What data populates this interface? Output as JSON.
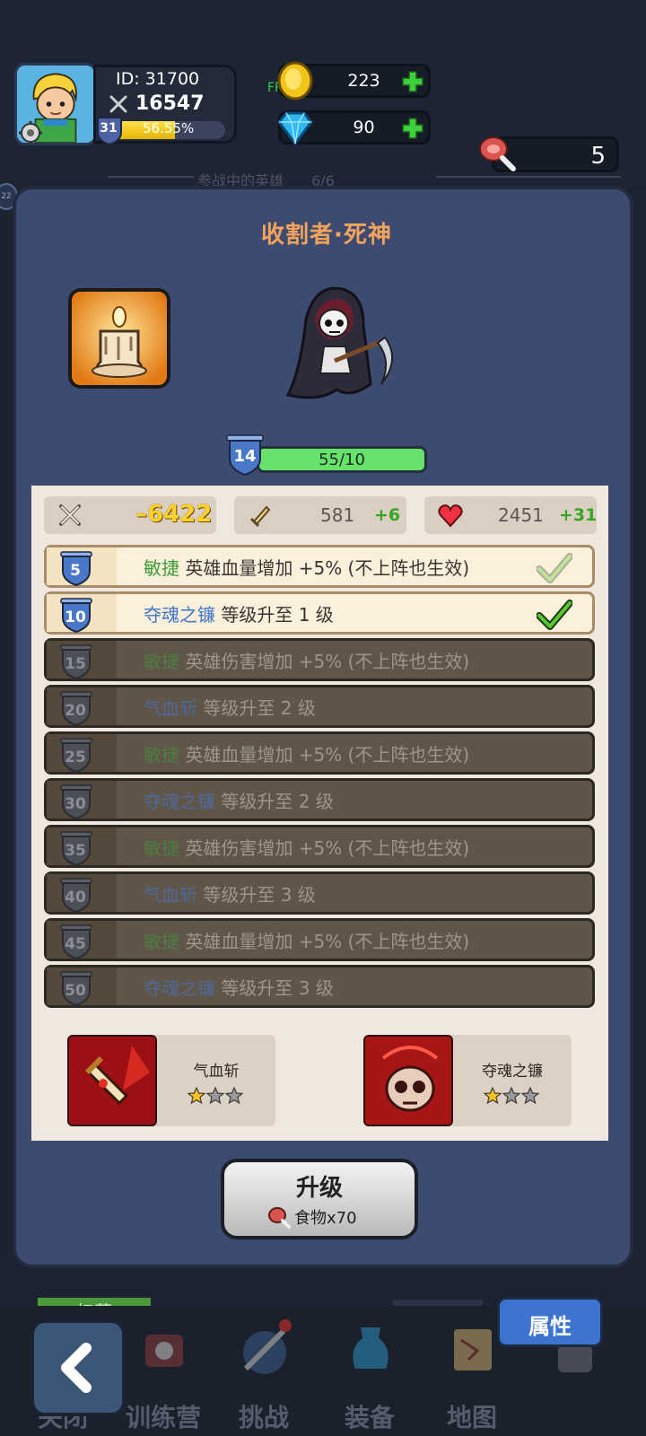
{
  "header": {
    "player_id": "ID: 31700",
    "combat_power": "16547",
    "player_level": "31",
    "xp_percent": "56.55%",
    "xp_fraction": 0.5655,
    "fps": "FPS60",
    "gold": "223",
    "gems": "90",
    "meat": "5",
    "heroes_hint": "参战中的英雄",
    "heroes_count": "6/6",
    "side_badge": "22"
  },
  "hero": {
    "title": "收割者·死神",
    "level": "14",
    "exp_text": "55/10",
    "exp_fraction": 1.0
  },
  "stats": {
    "attack": "–6422",
    "defense_value": "581",
    "defense_bonus": "+6",
    "hp_value": "2451",
    "hp_bonus": "+31"
  },
  "talents": [
    {
      "level": "5",
      "name": "敏捷",
      "kind": "agility",
      "desc": "英雄血量增加 +5% (不上阵也生效)",
      "unlocked": true,
      "check": "faded"
    },
    {
      "level": "10",
      "name": "夺魂之镰",
      "kind": "skill",
      "desc": "等级升至 1 级",
      "unlocked": true,
      "check": "solid"
    },
    {
      "level": "15",
      "name": "敏捷",
      "kind": "agility",
      "desc": "英雄伤害增加 +5% (不上阵也生效)",
      "unlocked": false
    },
    {
      "level": "20",
      "name": "气血斩",
      "kind": "skill",
      "desc": "等级升至 2 级",
      "unlocked": false
    },
    {
      "level": "25",
      "name": "敏捷",
      "kind": "agility",
      "desc": "英雄血量增加 +5% (不上阵也生效)",
      "unlocked": false
    },
    {
      "level": "30",
      "name": "夺魂之镰",
      "kind": "skill",
      "desc": "等级升至 2 级",
      "unlocked": false
    },
    {
      "level": "35",
      "name": "敏捷",
      "kind": "agility",
      "desc": "英雄伤害增加 +5% (不上阵也生效)",
      "unlocked": false
    },
    {
      "level": "40",
      "name": "气血斩",
      "kind": "skill",
      "desc": "等级升至 3 级",
      "unlocked": false
    },
    {
      "level": "45",
      "name": "敏捷",
      "kind": "agility",
      "desc": "英雄血量增加 +5% (不上阵也生效)",
      "unlocked": false
    },
    {
      "level": "50",
      "name": "夺魂之镰",
      "kind": "skill",
      "desc": "等级升至 3 级",
      "unlocked": false
    }
  ],
  "skills": [
    {
      "name": "气血斩",
      "stars": 1,
      "max_stars": 3
    },
    {
      "name": "夺魂之镰",
      "stars": 1,
      "max_stars": 3
    }
  ],
  "upgrade": {
    "label": "升级",
    "cost": "食物x70"
  },
  "attribute_button": "属性",
  "green_stub_label": "扫荡",
  "nav": {
    "items": [
      "关闭",
      "训练营",
      "挑战",
      "装备",
      "地图"
    ]
  },
  "colors": {
    "accent_title": "#f3a35c",
    "agility": "#3f9c3a",
    "skill": "#3e77c9",
    "bonus_green": "#34a624"
  }
}
